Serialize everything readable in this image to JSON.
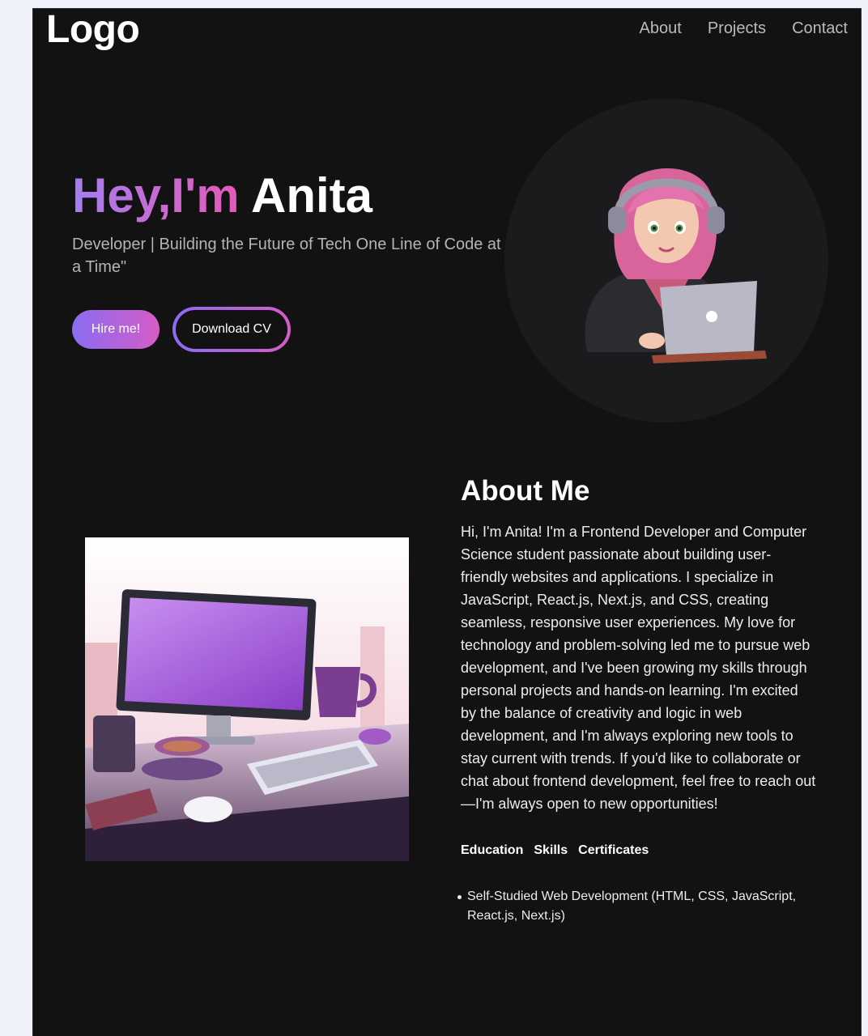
{
  "header": {
    "logo": "Logo",
    "nav": [
      "About",
      "Projects",
      "Contact"
    ]
  },
  "hero": {
    "greeting": "Hey,I'm",
    "name": "Anita",
    "tagline": "Developer | Building the Future of Tech One Line of Code at a Time\"",
    "hire_label": "Hire me!",
    "cv_label": "Download CV"
  },
  "about": {
    "title": "About Me",
    "body": "Hi, I'm Anita! I'm a Frontend Developer and Computer Science student passionate about building user-friendly websites and applications. I specialize in JavaScript, React.js, Next.js, and CSS, creating seamless, responsive user experiences. My love for technology and problem-solving led me to pursue web development, and I've been growing my skills through personal projects and hands-on learning. I'm excited by the balance of creativity and logic in web development, and I'm always exploring new tools to stay current with trends. If you'd like to collaborate or chat about frontend development, feel free to reach out—I'm always open to new opportunities!",
    "tabs": [
      "Education",
      "Skills",
      "Certificates"
    ],
    "items": [
      "Self-Studied Web Development (HTML, CSS, JavaScript, React.js, Next.js)"
    ]
  },
  "colors": {
    "background": "#121213",
    "accent_start": "#8a6cf2",
    "accent_end": "#d65cc6",
    "avatar_circle": "#1b1b1d"
  }
}
